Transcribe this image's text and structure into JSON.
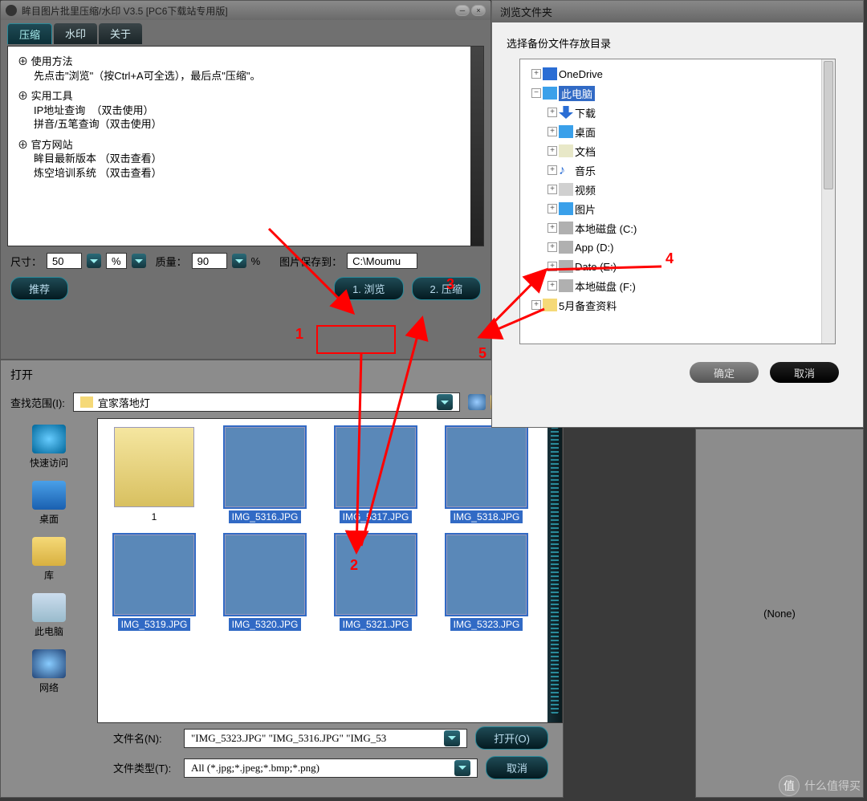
{
  "main": {
    "title": "眸目图片批里压缩/水印 V3.5  [PC6下载站专用版]",
    "tabs": [
      "压缩",
      "水印",
      "关于"
    ],
    "info": {
      "g1_title": "使用方法",
      "g1_l1": "先点击\"浏览\"（按Ctrl+A可全选），最后点\"压缩\"。",
      "g2_title": "实用工具",
      "g2_l1": "IP地址查询  （双击使用）",
      "g2_l2": "拼音/五笔查询（双击使用）",
      "g3_title": "官方网站",
      "g3_l1": "眸目最新版本 （双击查看）",
      "g3_l2": "炼空培训系统 （双击查看）"
    },
    "size_label": "尺寸：",
    "size_value": "50",
    "pct1": "%",
    "quality_label": "质量：",
    "quality_value": "90",
    "pct2": "%",
    "save_to_label": "图片保存到：",
    "save_to_value": "C:\\Moumu",
    "recommend_btn": "推荐",
    "browse_btn": "1. 浏览",
    "compress_btn": "2. 压缩"
  },
  "open": {
    "title": "打开",
    "range_label": "查找范围(I):",
    "range_value": "宜家落地灯",
    "sidebar": [
      "快速访问",
      "桌面",
      "库",
      "此电脑",
      "网络"
    ],
    "files": [
      {
        "label": "1",
        "folder": true,
        "sel": false
      },
      {
        "label": "IMG_5316.JPG",
        "folder": false,
        "sel": true
      },
      {
        "label": "IMG_5317.JPG",
        "folder": false,
        "sel": true
      },
      {
        "label": "IMG_5318.JPG",
        "folder": false,
        "sel": true
      },
      {
        "label": "IMG_5319.JPG",
        "folder": false,
        "sel": true
      },
      {
        "label": "IMG_5320.JPG",
        "folder": false,
        "sel": true
      },
      {
        "label": "IMG_5321.JPG",
        "folder": false,
        "sel": true
      },
      {
        "label": "IMG_5323.JPG",
        "folder": false,
        "sel": true
      }
    ],
    "filename_label": "文件名(N):",
    "filename_value": "\"IMG_5323.JPG\" \"IMG_5316.JPG\" \"IMG_53",
    "filetype_label": "文件类型(T):",
    "filetype_value": "All (*.jpg;*.jpeg;*.bmp;*.png)",
    "open_btn": "打开(O)",
    "cancel_btn": "取消"
  },
  "browse": {
    "title": "浏览文件夹",
    "prompt": "选择备份文件存放目录",
    "tree": [
      {
        "exp": "+",
        "level": 1,
        "icon": "#2a6dd4",
        "label": "OneDrive",
        "sel": false
      },
      {
        "exp": "−",
        "level": 1,
        "icon": "#3aa0ea",
        "label": "此电脑",
        "sel": true
      },
      {
        "exp": "+",
        "level": 2,
        "icon": "#2a6dd4",
        "label": "下载",
        "sel": false,
        "arrow": true
      },
      {
        "exp": "+",
        "level": 2,
        "icon": "#3aa0ea",
        "label": "桌面",
        "sel": false
      },
      {
        "exp": "+",
        "level": 2,
        "icon": "#e8e8c8",
        "label": "文档",
        "sel": false
      },
      {
        "exp": "+",
        "level": 2,
        "icon": "#3aa0ea",
        "label": "音乐",
        "sel": false,
        "note": true
      },
      {
        "exp": "+",
        "level": 2,
        "icon": "#d0d0d0",
        "label": "视频",
        "sel": false
      },
      {
        "exp": "+",
        "level": 2,
        "icon": "#3aa0ea",
        "label": "图片",
        "sel": false
      },
      {
        "exp": "+",
        "level": 2,
        "icon": "#b0b0b0",
        "label": "本地磁盘 (C:)",
        "sel": false
      },
      {
        "exp": "+",
        "level": 2,
        "icon": "#b0b0b0",
        "label": "App (D:)",
        "sel": false
      },
      {
        "exp": "+",
        "level": 2,
        "icon": "#b0b0b0",
        "label": "Date (E:)",
        "sel": false
      },
      {
        "exp": "+",
        "level": 2,
        "icon": "#b0b0b0",
        "label": "本地磁盘 (F:)",
        "sel": false
      },
      {
        "exp": "+",
        "level": 1,
        "icon": "#f5d978",
        "label": "5月备查资料",
        "sel": false
      }
    ],
    "ok_btn": "确定",
    "cancel_btn": "取消"
  },
  "none_label": "(None)",
  "annotations": {
    "a1": "1",
    "a2": "2",
    "a3": "3",
    "a4": "4",
    "a5": "5"
  },
  "watermark": {
    "icon": "值",
    "text": "什么值得买"
  }
}
